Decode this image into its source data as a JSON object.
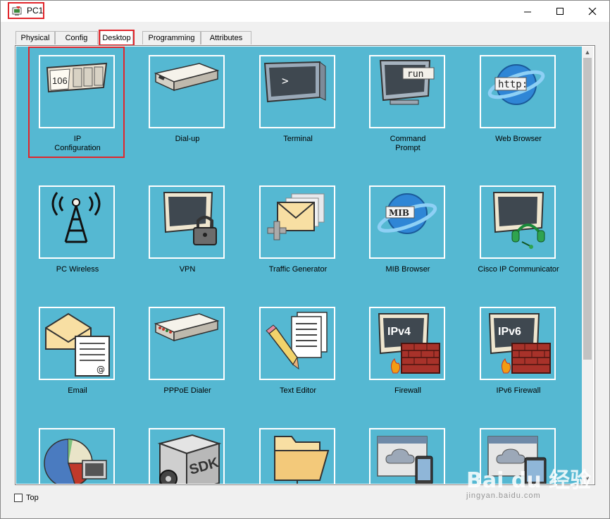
{
  "window": {
    "title": "PC1"
  },
  "tabs": [
    {
      "label": "Physical"
    },
    {
      "label": "Config"
    },
    {
      "label": "Desktop"
    },
    {
      "label": "Programming"
    },
    {
      "label": "Attributes"
    }
  ],
  "active_tab": "Desktop",
  "apps": [
    {
      "label": "IP\nConfiguration",
      "icon": "ip-configuration-icon"
    },
    {
      "label": "Dial-up",
      "icon": "dial-up-modem-icon"
    },
    {
      "label": "Terminal",
      "icon": "terminal-icon"
    },
    {
      "label": "Command\nPrompt",
      "icon": "command-prompt-icon"
    },
    {
      "label": "Web Browser",
      "icon": "web-browser-icon"
    },
    {
      "label": "PC Wireless",
      "icon": "pc-wireless-icon"
    },
    {
      "label": "VPN",
      "icon": "vpn-icon"
    },
    {
      "label": "Traffic Generator",
      "icon": "traffic-generator-icon"
    },
    {
      "label": "MIB Browser",
      "icon": "mib-browser-icon"
    },
    {
      "label": "Cisco IP Communicator",
      "icon": "ip-communicator-icon"
    },
    {
      "label": "Email",
      "icon": "email-icon"
    },
    {
      "label": "PPPoE Dialer",
      "icon": "pppoe-dialer-icon"
    },
    {
      "label": "Text Editor",
      "icon": "text-editor-icon"
    },
    {
      "label": "Firewall",
      "icon": "firewall-icon"
    },
    {
      "label": "IPv6 Firewall",
      "icon": "ipv6-firewall-icon"
    },
    {
      "label": "",
      "icon": "pie-chart-pc-icon"
    },
    {
      "label": "",
      "icon": "sdk-box-icon"
    },
    {
      "label": "",
      "icon": "folder-network-icon"
    },
    {
      "label": "",
      "icon": "cloud-window-phone-icon"
    },
    {
      "label": "",
      "icon": "cloud-window-tablet-icon"
    }
  ],
  "icon_text": {
    "ip": "106",
    "cmd": "run",
    "browser": "http:",
    "mib": "MIB",
    "fw4": "IPv4",
    "fw6": "IPv6",
    "sdk": "SDK"
  },
  "footer": {
    "top_label": "Top",
    "top_checked": false
  },
  "watermark": {
    "brand": "Bai du 经验",
    "url": "jingyan.baidu.com"
  },
  "colors": {
    "desktop_bg": "#55b8d2",
    "highlight": "#e1262c",
    "tile_border": "#ffffff"
  }
}
